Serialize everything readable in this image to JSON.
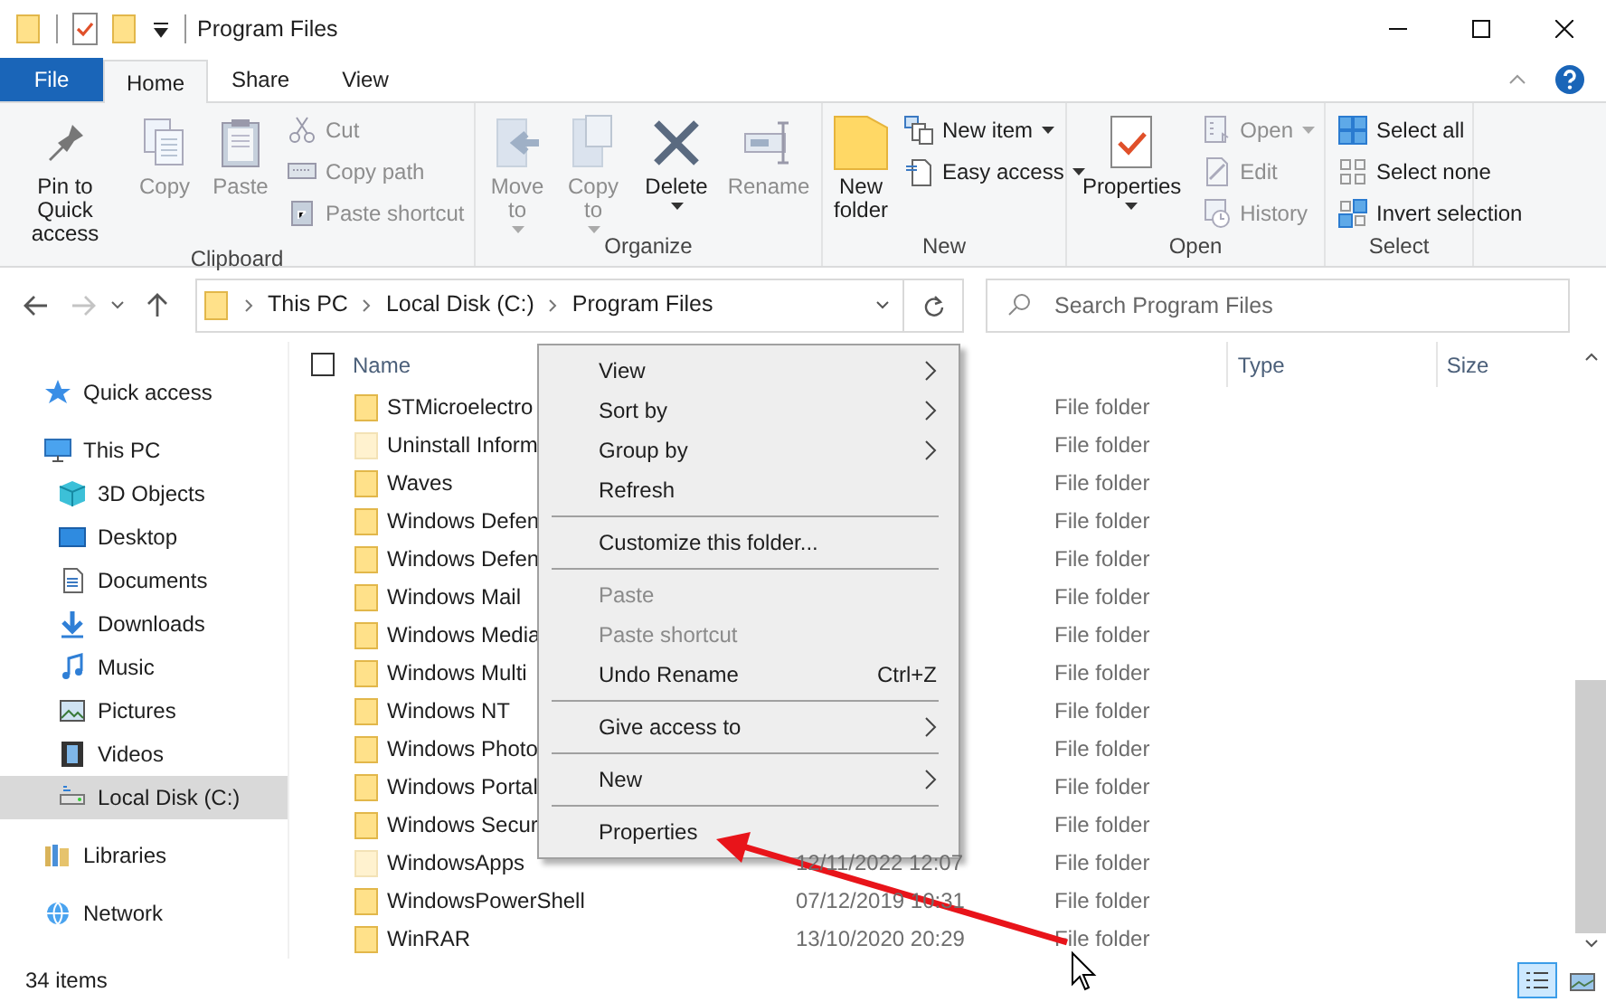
{
  "window": {
    "title": "Program Files"
  },
  "ribbon_tabs": [
    {
      "label": "File",
      "kind": "file",
      "selected": false
    },
    {
      "label": "Home",
      "kind": "tab",
      "selected": true
    },
    {
      "label": "Share",
      "kind": "tab",
      "selected": false
    },
    {
      "label": "View",
      "kind": "tab",
      "selected": false
    }
  ],
  "ribbon_groups": [
    {
      "label": "Clipboard",
      "items": [
        {
          "kind": "large",
          "label": "Pin to Quick access",
          "disabled": false,
          "dropdown": false
        },
        {
          "kind": "large",
          "label": "Copy",
          "disabled": true,
          "dropdown": false
        },
        {
          "kind": "large",
          "label": "Paste",
          "disabled": true,
          "dropdown": false
        },
        {
          "kind": "small",
          "label": "Cut",
          "disabled": true,
          "dropdown": false
        },
        {
          "kind": "small",
          "label": "Copy path",
          "disabled": true,
          "dropdown": false
        },
        {
          "kind": "small",
          "label": "Paste shortcut",
          "disabled": true,
          "dropdown": false
        }
      ]
    },
    {
      "label": "Organize",
      "items": [
        {
          "kind": "large",
          "label": "Move to",
          "disabled": true,
          "dropdown": true
        },
        {
          "kind": "large",
          "label": "Copy to",
          "disabled": true,
          "dropdown": true
        },
        {
          "kind": "large",
          "label": "Delete",
          "disabled": false,
          "dropdown": true
        },
        {
          "kind": "large",
          "label": "Rename",
          "disabled": true,
          "dropdown": false
        }
      ]
    },
    {
      "label": "New",
      "items": [
        {
          "kind": "large",
          "label": "New folder",
          "disabled": false,
          "dropdown": false
        },
        {
          "kind": "small",
          "label": "New item",
          "disabled": false,
          "dropdown": true
        },
        {
          "kind": "small",
          "label": "Easy access",
          "disabled": false,
          "dropdown": true
        }
      ]
    },
    {
      "label": "Open",
      "items": [
        {
          "kind": "large",
          "label": "Properties",
          "disabled": false,
          "dropdown": true
        },
        {
          "kind": "small",
          "label": "Open",
          "disabled": true,
          "dropdown": true
        },
        {
          "kind": "small",
          "label": "Edit",
          "disabled": true,
          "dropdown": false
        },
        {
          "kind": "small",
          "label": "History",
          "disabled": true,
          "dropdown": false
        }
      ]
    },
    {
      "label": "Select",
      "items": [
        {
          "kind": "small",
          "label": "Select all",
          "disabled": false,
          "dropdown": false
        },
        {
          "kind": "small",
          "label": "Select none",
          "disabled": false,
          "dropdown": false
        },
        {
          "kind": "small",
          "label": "Invert selection",
          "disabled": false,
          "dropdown": false
        }
      ]
    }
  ],
  "address_bar": {
    "breadcrumbs": [
      "This PC",
      "Local Disk (C:)",
      "Program Files"
    ]
  },
  "search": {
    "placeholder": "Search Program Files"
  },
  "sidebar": {
    "items": [
      {
        "label": "Quick access",
        "selected": false
      },
      {
        "label": "This PC",
        "selected": false,
        "children": [
          {
            "label": "3D Objects",
            "selected": false
          },
          {
            "label": "Desktop",
            "selected": false
          },
          {
            "label": "Documents",
            "selected": false
          },
          {
            "label": "Downloads",
            "selected": false
          },
          {
            "label": "Music",
            "selected": false
          },
          {
            "label": "Pictures",
            "selected": false
          },
          {
            "label": "Videos",
            "selected": false
          },
          {
            "label": "Local Disk (C:)",
            "selected": true
          }
        ]
      },
      {
        "label": "Libraries",
        "selected": false
      },
      {
        "label": "Network",
        "selected": false
      }
    ]
  },
  "file_list": {
    "select_all_checked": false,
    "columns": [
      "Name",
      "Type",
      "Size"
    ],
    "rows": [
      {
        "name": "STMicroelectro",
        "type": "File folder",
        "hidden": false
      },
      {
        "name": "Uninstall Inform",
        "type": "File folder",
        "hidden": true
      },
      {
        "name": "Waves",
        "type": "File folder",
        "hidden": false
      },
      {
        "name": "Windows Defen",
        "type": "File folder",
        "hidden": false
      },
      {
        "name": "Windows Defen",
        "type": "File folder",
        "hidden": false
      },
      {
        "name": "Windows Mail",
        "type": "File folder",
        "hidden": false
      },
      {
        "name": "Windows Media",
        "type": "File folder",
        "hidden": false
      },
      {
        "name": "Windows Multi",
        "type": "File folder",
        "hidden": false
      },
      {
        "name": "Windows NT",
        "type": "File folder",
        "hidden": false
      },
      {
        "name": "Windows Photo",
        "type": "File folder",
        "hidden": false
      },
      {
        "name": "Windows Portal",
        "type": "File folder",
        "hidden": false
      },
      {
        "name": "Windows Secur",
        "type": "File folder",
        "hidden": false
      },
      {
        "name": "WindowsApps",
        "date": "12/11/2022 12:07",
        "type": "File folder",
        "hidden": true
      },
      {
        "name": "WindowsPowerShell",
        "date": "07/12/2019 10:31",
        "type": "File folder",
        "hidden": false
      },
      {
        "name": "WinRAR",
        "date": "13/10/2020 20:29",
        "type": "File folder",
        "hidden": false
      }
    ]
  },
  "context_menu": {
    "items": [
      {
        "kind": "item",
        "label": "View",
        "disabled": false,
        "submenu": true
      },
      {
        "kind": "item",
        "label": "Sort by",
        "disabled": false,
        "submenu": true
      },
      {
        "kind": "item",
        "label": "Group by",
        "disabled": false,
        "submenu": true
      },
      {
        "kind": "item",
        "label": "Refresh",
        "disabled": false,
        "submenu": false
      },
      {
        "kind": "separator"
      },
      {
        "kind": "item",
        "label": "Customize this folder...",
        "disabled": false,
        "submenu": false
      },
      {
        "kind": "separator"
      },
      {
        "kind": "item",
        "label": "Paste",
        "disabled": true,
        "submenu": false
      },
      {
        "kind": "item",
        "label": "Paste shortcut",
        "disabled": true,
        "submenu": false
      },
      {
        "kind": "item",
        "label": "Undo Rename",
        "disabled": false,
        "submenu": false,
        "shortcut": "Ctrl+Z"
      },
      {
        "kind": "separator"
      },
      {
        "kind": "item",
        "label": "Give access to",
        "disabled": false,
        "submenu": true
      },
      {
        "kind": "separator"
      },
      {
        "kind": "item",
        "label": "New",
        "disabled": false,
        "submenu": true
      },
      {
        "kind": "separator"
      },
      {
        "kind": "item",
        "label": "Properties",
        "disabled": false,
        "submenu": false
      }
    ]
  },
  "status_bar": {
    "item_count": "34 items",
    "views": [
      {
        "selected": true
      },
      {
        "selected": false
      }
    ]
  }
}
